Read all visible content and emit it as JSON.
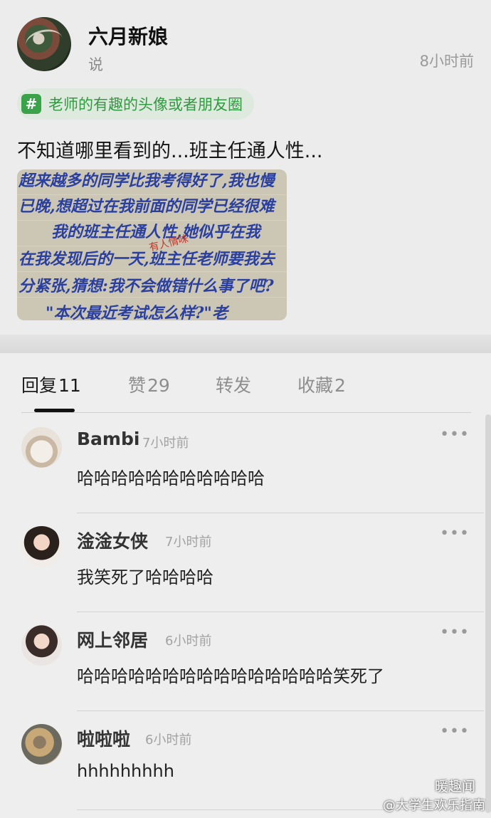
{
  "post": {
    "username": "六月新娘",
    "subtitle": "说",
    "time": "8小时前",
    "tag": {
      "icon": "#",
      "label": "老师的有趣的头像或者朋友圈"
    },
    "text": "不知道哪里看到的...班主任通人性...",
    "image_lines": [
      "超来越多的同学比我考得好了,我也慢",
      "已晚,想超过在我前面的同学已经很难",
      "我的班主任通人性,她似乎在我",
      "在我发现后的一天,班主任老师要我去",
      "分紧张,猜想:我不会做错什么事了吧?",
      "\"本次最近考试怎么样?\"老"
    ],
    "image_note": "有人情味"
  },
  "tabs": [
    {
      "label": "回复",
      "count": "11"
    },
    {
      "label": "赞",
      "count": "29"
    },
    {
      "label": "转发",
      "count": ""
    },
    {
      "label": "收藏",
      "count": "2"
    }
  ],
  "comments": [
    {
      "name": "Bambi",
      "time": "7小时前",
      "text": "哈哈哈哈哈哈哈哈哈哈哈",
      "more": "•••"
    },
    {
      "name": "淦淦女侠",
      "time": "7小时前",
      "text": "我笑死了哈哈哈哈",
      "more": "•••"
    },
    {
      "name": "网上邻居",
      "time": "6小时前",
      "text": "哈哈哈哈哈哈哈哈哈哈哈哈哈哈哈笑死了",
      "more": "•••"
    },
    {
      "name": "啦啦啦",
      "time": "6小时前",
      "text": "hhhhhhhhh",
      "more": "•••"
    }
  ],
  "watermark": {
    "top": "暖趣闻",
    "bottom": "@大学生欢乐指南"
  }
}
